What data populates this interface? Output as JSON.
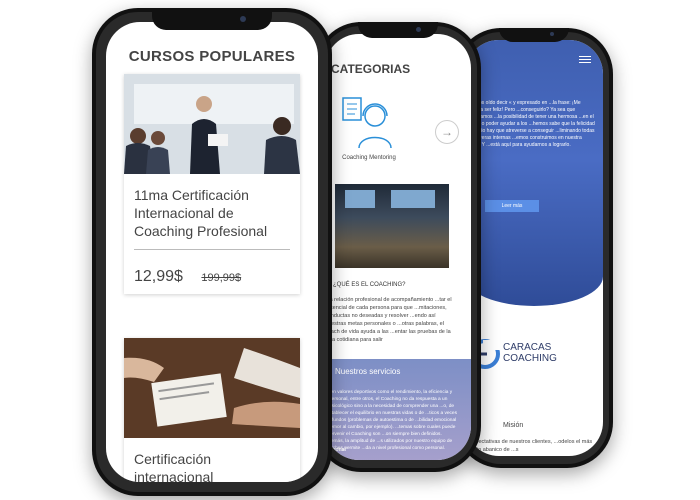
{
  "phone1": {
    "title": "CURSOS POPULARES",
    "cards": [
      {
        "title": "11ma Certificación Internacional de Coaching Profesional",
        "price": "12,99$",
        "old_price": "199,99$"
      },
      {
        "title": "Certificación internacional COACHING"
      }
    ]
  },
  "phone2": {
    "heading": "CATEGORIAS",
    "category": {
      "label": "Coaching Mentoring",
      "icon": "coach-headset-icon"
    },
    "arrow": "→",
    "question": "¿QUÉ ES EL COACHING?",
    "question_body": "...a relación profesional de acompañamiento ...tar el potencial de cada persona para que ...mitaciones, conductas no deseadas y resolver ...endo así nuestras metas personales o ...otras palabras, el coach de vida ayuda a las ...entar las pruebas de la vida cotidiana para salir",
    "services_title": "Nuestros servicios",
    "services_body": "...ren valores deportivos como el rendimiento, la eficiencia y ...personal, entre otros, el Coaching no da respuesta a un ...psicológico sino a la necesidad de comprender una ...o, de restablecer el equilibrio en nuestras vidas o de ...ticos a veces profundos (problemas de autoestima o de ...bilidad emocional o temor al cambio, por ejemplo). ...temas sobre cuales puede intervenir el Coaching son ...on siempre bien definidos. Además, la amplitud de ...s utilizados por nuestro equipo de coaches permite ...da a nivel profesional como personal.",
    "services_footer": "personal"
  },
  "phone3": {
    "hero_text": "...hemos oído decir « y expresado en ...la frase: ¡Me gustaría ser feliz! Pero ...conseguirlo? Ya sea que entendamos ...la posibilidad de tener una hermosa ...en el trabajo o poder ayudar a los ...hemos sabe que la felicidad es ...ddio hay que atreverse a conseguir ...liminando todas las barreras internas ...emos construimos en nuestra mente. Y ...está aquí para ayudarnos a lograrlo.",
    "button": "Leer más",
    "logo_line1": "CARACAS",
    "logo_line2": "COACHING",
    "mision_title": "Misión",
    "mision_body": "...espectativas de nuestros clientes, ...odelos el más amplio abanico de ...s"
  },
  "colors": {
    "hero": "#4466bb",
    "services": "#8f98c8",
    "accent": "#3b7fd6"
  }
}
